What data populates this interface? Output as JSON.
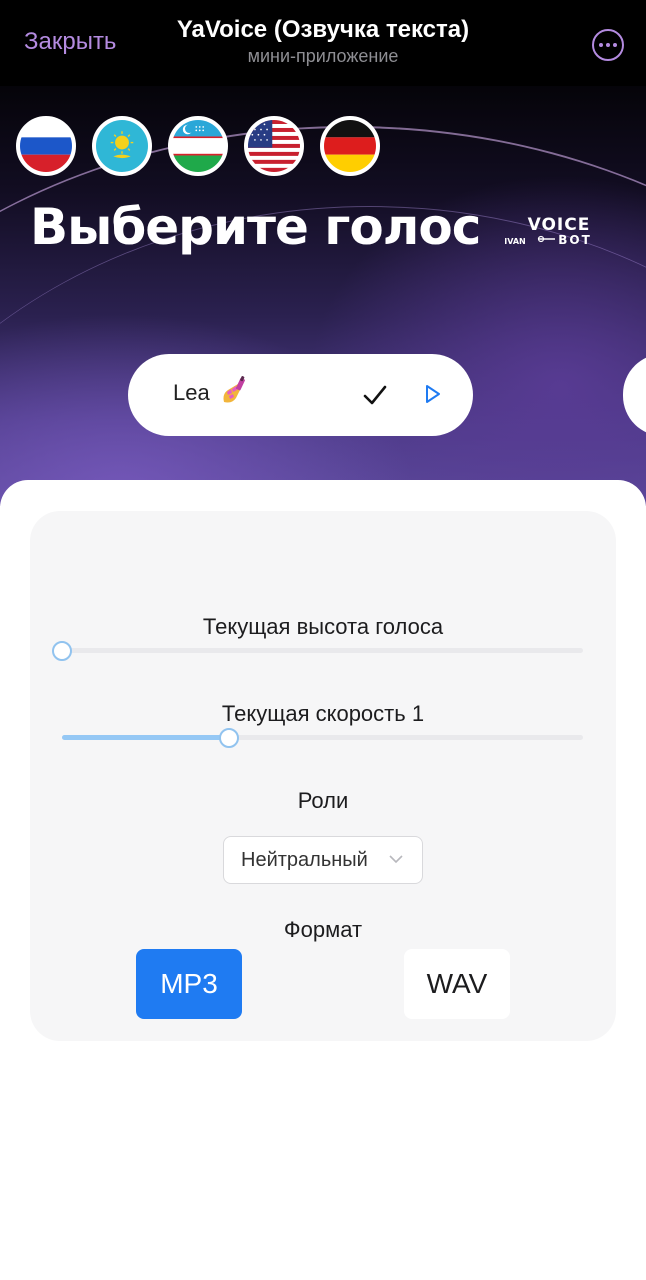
{
  "topbar": {
    "close_label": "Закрыть",
    "title": "YaVoice (Озвучка текста)",
    "subtitle": "мини-приложение"
  },
  "hero": {
    "title": "Выберите голос",
    "flags": [
      "russia-flag",
      "kazakhstan-flag",
      "uzbekistan-flag",
      "usa-flag",
      "germany-flag"
    ],
    "logo_text": "VOICE BOT"
  },
  "voice": {
    "name": "Lea",
    "emoji_icon": "nail-polish-icon",
    "selected": true
  },
  "settings": {
    "pitch_label": "Текущая высота голоса",
    "pitch_value": 0,
    "speed_label": "Текущая скорость 1",
    "speed_value": 0.32,
    "roles_label": "Роли",
    "role_selected": "Нейтральный",
    "format_label": "Формат",
    "formats": [
      "MP3",
      "WAV"
    ],
    "format_selected": "MP3"
  },
  "colors": {
    "accent": "#1f7bf2",
    "close_text": "#b48be0",
    "slider_fill": "#95c8f5"
  }
}
